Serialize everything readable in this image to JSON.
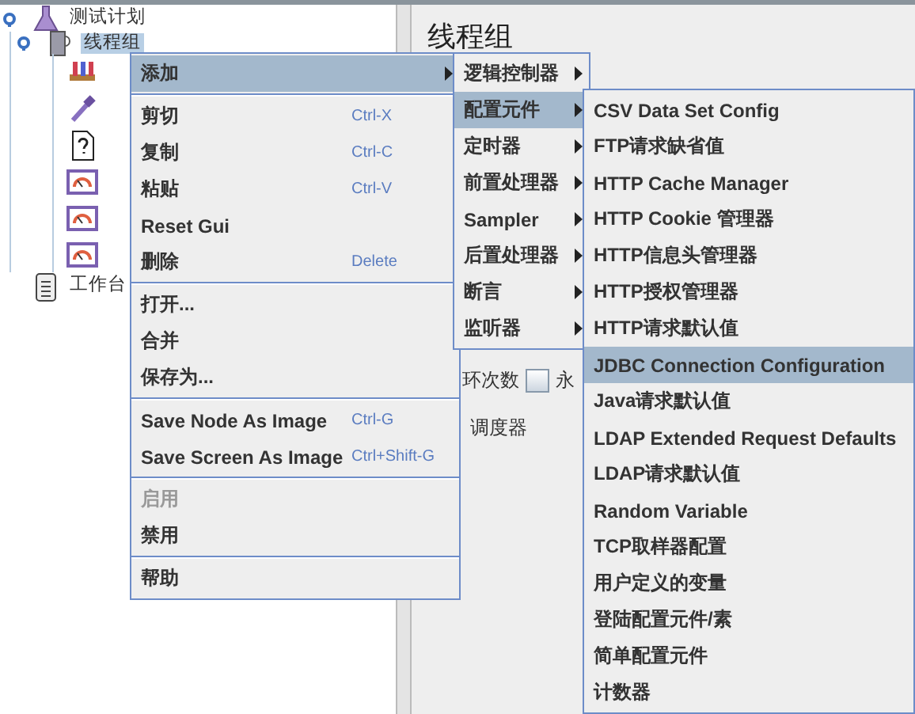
{
  "tree": {
    "items": [
      {
        "label": "测试计划",
        "kind": "plan",
        "selected": false,
        "expanded": true,
        "children": [
          {
            "label": "线程组",
            "kind": "threads",
            "selected": true,
            "expanded": true,
            "children": [
              {
                "kind": "rack"
              },
              {
                "kind": "dropper"
              },
              {
                "kind": "unknown"
              },
              {
                "kind": "listener"
              },
              {
                "kind": "listener"
              },
              {
                "kind": "listener"
              }
            ]
          }
        ]
      },
      {
        "label": "工作台",
        "kind": "workbench",
        "selected": false
      }
    ]
  },
  "panel": {
    "title": "线程组",
    "loop_label": "环次数",
    "forever": {
      "label": "永",
      "checked": false
    },
    "scheduler_label": "调度器"
  },
  "context_menu": [
    {
      "kind": "item",
      "label": "添加",
      "submenu": true,
      "selected": true,
      "disabled": false
    },
    {
      "kind": "separator"
    },
    {
      "kind": "item",
      "label": "剪切",
      "shortcut": "Ctrl-X",
      "submenu": false,
      "selected": false,
      "disabled": false
    },
    {
      "kind": "item",
      "label": "复制",
      "shortcut": "Ctrl-C",
      "submenu": false,
      "selected": false,
      "disabled": false
    },
    {
      "kind": "item",
      "label": "粘贴",
      "shortcut": "Ctrl-V",
      "submenu": false,
      "selected": false,
      "disabled": false
    },
    {
      "kind": "item",
      "label": "Reset Gui",
      "submenu": false,
      "selected": false,
      "disabled": false
    },
    {
      "kind": "item",
      "label": "删除",
      "shortcut": "Delete",
      "submenu": false,
      "selected": false,
      "disabled": false
    },
    {
      "kind": "separator"
    },
    {
      "kind": "item",
      "label": "打开...",
      "submenu": false,
      "selected": false,
      "disabled": false
    },
    {
      "kind": "item",
      "label": "合并",
      "submenu": false,
      "selected": false,
      "disabled": false
    },
    {
      "kind": "item",
      "label": "保存为...",
      "submenu": false,
      "selected": false,
      "disabled": false
    },
    {
      "kind": "separator"
    },
    {
      "kind": "item",
      "label": "Save Node As Image",
      "shortcut": "Ctrl-G",
      "submenu": false,
      "selected": false,
      "disabled": false
    },
    {
      "kind": "item",
      "label": "Save Screen As Image",
      "shortcut": "Ctrl+Shift-G",
      "submenu": false,
      "selected": false,
      "disabled": false
    },
    {
      "kind": "separator"
    },
    {
      "kind": "item",
      "label": "启用",
      "submenu": false,
      "selected": false,
      "disabled": true
    },
    {
      "kind": "item",
      "label": "禁用",
      "submenu": false,
      "selected": false,
      "disabled": false
    },
    {
      "kind": "separator"
    },
    {
      "kind": "item",
      "label": "帮助",
      "submenu": false,
      "selected": false,
      "disabled": false
    }
  ],
  "add_menu": [
    {
      "kind": "item",
      "label": "逻辑控制器",
      "submenu": true,
      "selected": false,
      "disabled": false
    },
    {
      "kind": "item",
      "label": "配置元件",
      "submenu": true,
      "selected": true,
      "disabled": false
    },
    {
      "kind": "item",
      "label": "定时器",
      "submenu": true,
      "selected": false,
      "disabled": false
    },
    {
      "kind": "item",
      "label": "前置处理器",
      "submenu": true,
      "selected": false,
      "disabled": false
    },
    {
      "kind": "item",
      "label": "Sampler",
      "submenu": true,
      "selected": false,
      "disabled": false
    },
    {
      "kind": "item",
      "label": "后置处理器",
      "submenu": true,
      "selected": false,
      "disabled": false
    },
    {
      "kind": "item",
      "label": "断言",
      "submenu": true,
      "selected": false,
      "disabled": false
    },
    {
      "kind": "item",
      "label": "监听器",
      "submenu": true,
      "selected": false,
      "disabled": false
    }
  ],
  "config_menu": [
    {
      "kind": "item",
      "label": "CSV Data Set Config",
      "submenu": false,
      "selected": false,
      "disabled": false
    },
    {
      "kind": "item",
      "label": "FTP请求缺省值",
      "submenu": false,
      "selected": false,
      "disabled": false
    },
    {
      "kind": "item",
      "label": "HTTP Cache Manager",
      "submenu": false,
      "selected": false,
      "disabled": false
    },
    {
      "kind": "item",
      "label": "HTTP Cookie 管理器",
      "submenu": false,
      "selected": false,
      "disabled": false
    },
    {
      "kind": "item",
      "label": "HTTP信息头管理器",
      "submenu": false,
      "selected": false,
      "disabled": false
    },
    {
      "kind": "item",
      "label": "HTTP授权管理器",
      "submenu": false,
      "selected": false,
      "disabled": false
    },
    {
      "kind": "item",
      "label": "HTTP请求默认值",
      "submenu": false,
      "selected": false,
      "disabled": false
    },
    {
      "kind": "item",
      "label": "JDBC Connection Configuration",
      "submenu": false,
      "selected": true,
      "disabled": false
    },
    {
      "kind": "item",
      "label": "Java请求默认值",
      "submenu": false,
      "selected": false,
      "disabled": false
    },
    {
      "kind": "item",
      "label": "LDAP Extended Request Defaults",
      "submenu": false,
      "selected": false,
      "disabled": false
    },
    {
      "kind": "item",
      "label": "LDAP请求默认值",
      "submenu": false,
      "selected": false,
      "disabled": false
    },
    {
      "kind": "item",
      "label": "Random Variable",
      "submenu": false,
      "selected": false,
      "disabled": false
    },
    {
      "kind": "item",
      "label": "TCP取样器配置",
      "submenu": false,
      "selected": false,
      "disabled": false
    },
    {
      "kind": "item",
      "label": "用户定义的变量",
      "submenu": false,
      "selected": false,
      "disabled": false
    },
    {
      "kind": "item",
      "label": "登陆配置元件/素",
      "submenu": false,
      "selected": false,
      "disabled": false
    },
    {
      "kind": "item",
      "label": "简单配置元件",
      "submenu": false,
      "selected": false,
      "disabled": false
    },
    {
      "kind": "item",
      "label": "计数器",
      "submenu": false,
      "selected": false,
      "disabled": false
    }
  ]
}
